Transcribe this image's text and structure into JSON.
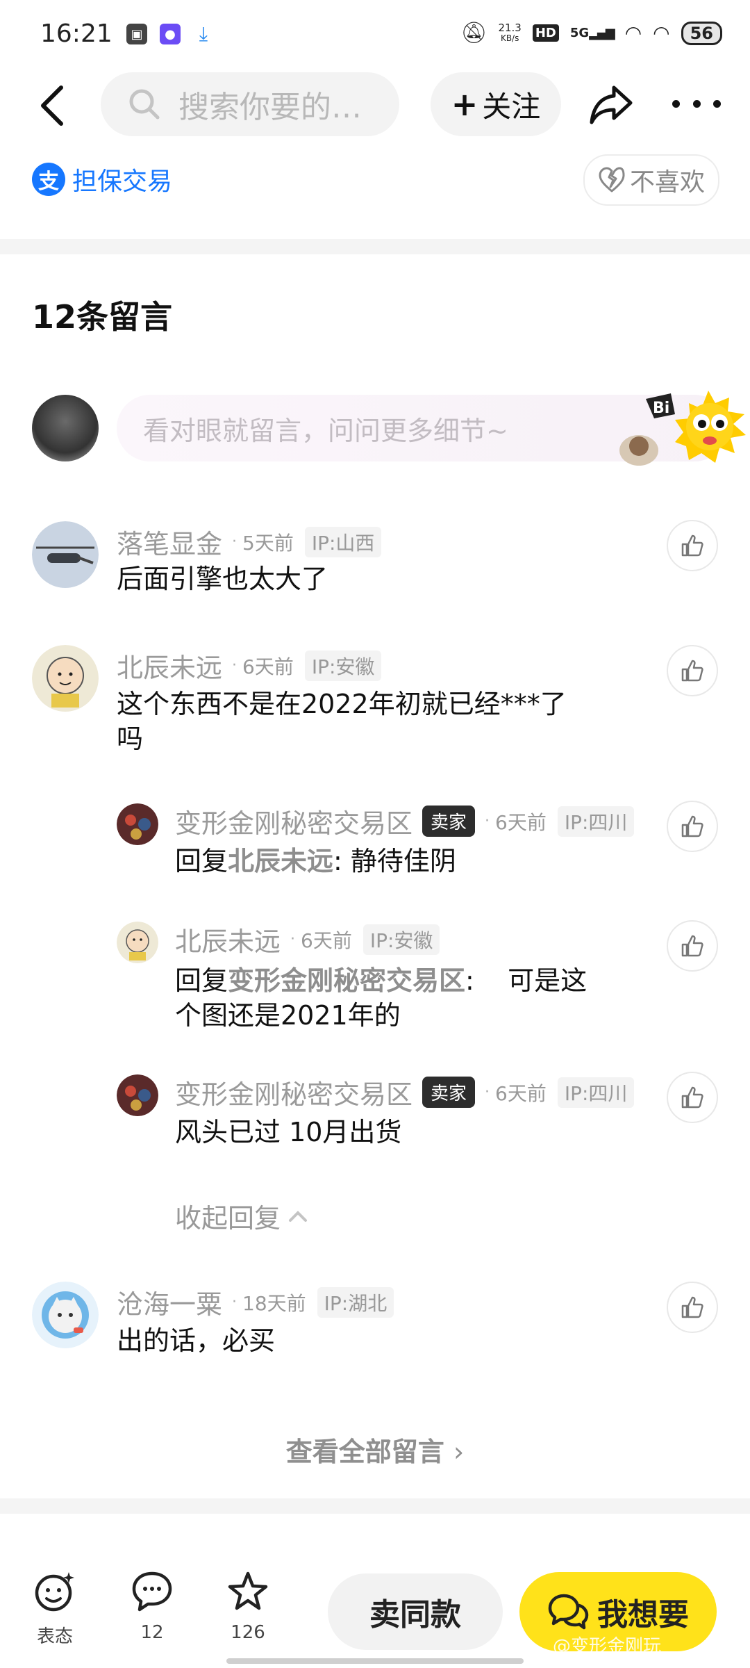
{
  "status_bar": {
    "time": "16:21",
    "network_speed_value": "21.3",
    "network_speed_unit": "KB/s",
    "hd": "HD",
    "signal": "5G",
    "battery": "56"
  },
  "nav": {
    "search_placeholder": "搜索你要的…",
    "follow_label": "关注",
    "guarantee_label": "担保交易",
    "dislike_label": "不喜欢"
  },
  "comments": {
    "title": "12条留言",
    "input_placeholder": "看对眼就留言，问问更多细节~",
    "mascot_text": "Bi",
    "items": [
      {
        "user": "落笔显金",
        "time": "5天前",
        "ip": "IP:山西",
        "text": "后面引擎也太大了"
      },
      {
        "user": "北辰未远",
        "time": "6天前",
        "ip": "IP:安徽",
        "text_line1": "这个东西不是在2022年初就已经***了",
        "text_line2": "吗"
      },
      {
        "user": "变形金刚秘密交易区",
        "badge": "卖家",
        "time": "6天前",
        "ip": "IP:四川",
        "reply_prefix": "回复",
        "reply_to": "北辰未远",
        "text": ": 静待佳阴"
      },
      {
        "user": "北辰未远",
        "time": "6天前",
        "ip": "IP:安徽",
        "reply_prefix": "回复",
        "reply_to": "变形金刚秘密交易区",
        "text_line1": ":    可是这",
        "text_line2": "个图还是2021年的"
      },
      {
        "user": "变形金刚秘密交易区",
        "badge": "卖家",
        "time": "6天前",
        "ip": "IP:四川",
        "text": "风头已过 10月出货"
      },
      {
        "user": "沧海一粟",
        "time": "18天前",
        "ip": "IP:湖北",
        "text": "出的话，必买"
      }
    ],
    "collapse_label": "收起回复",
    "view_all_label": "查看全部留言"
  },
  "bottom_bar": {
    "tabs": [
      {
        "label": "表态"
      },
      {
        "label": "12"
      },
      {
        "label": "126"
      }
    ],
    "same_label": "卖同款",
    "want_label": "我想要",
    "watermark": "@变形金刚玩"
  },
  "colors": {
    "accent_yellow": "#ffe21a",
    "alipay_blue": "#1677ff",
    "seller_badge": "#2d2d2d"
  }
}
